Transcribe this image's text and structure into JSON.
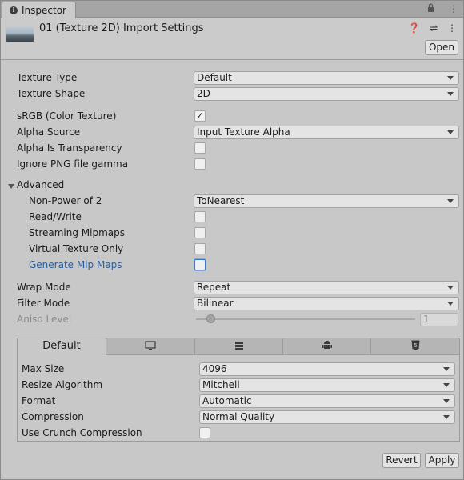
{
  "tab": {
    "label": "Inspector"
  },
  "header": {
    "title": "01 (Texture 2D) Import Settings",
    "open_label": "Open",
    "icons": [
      "help-icon",
      "presets-icon",
      "more-icon"
    ]
  },
  "settings": {
    "texture_type": {
      "label": "Texture Type",
      "value": "Default"
    },
    "texture_shape": {
      "label": "Texture Shape",
      "value": "2D"
    },
    "srgb": {
      "label": "sRGB (Color Texture)",
      "checked": true,
      "mark": "✓"
    },
    "alpha_source": {
      "label": "Alpha Source",
      "value": "Input Texture Alpha"
    },
    "alpha_transparency": {
      "label": "Alpha Is Transparency"
    },
    "ignore_png": {
      "label": "Ignore PNG file gamma"
    }
  },
  "advanced": {
    "label": "Advanced",
    "npot": {
      "label": "Non-Power of 2",
      "value": "ToNearest"
    },
    "read_write": {
      "label": "Read/Write"
    },
    "streaming": {
      "label": "Streaming Mipmaps"
    },
    "virtual": {
      "label": "Virtual Texture Only"
    },
    "mipmaps": {
      "label": "Generate Mip Maps"
    }
  },
  "wrap": {
    "label": "Wrap Mode",
    "value": "Repeat"
  },
  "filter": {
    "label": "Filter Mode",
    "value": "Bilinear"
  },
  "aniso": {
    "label": "Aniso Level",
    "value": "1"
  },
  "platform": {
    "tabs": [
      "Default",
      "standalone-icon",
      "server-icon",
      "android-icon",
      "webgl-icon"
    ],
    "default_label": "Default",
    "max_size": {
      "label": "Max Size",
      "value": "4096"
    },
    "resize": {
      "label": "Resize Algorithm",
      "value": "Mitchell"
    },
    "format": {
      "label": "Format",
      "value": "Automatic"
    },
    "compression": {
      "label": "Compression",
      "value": "Normal Quality"
    },
    "crunch": {
      "label": "Use Crunch Compression"
    }
  },
  "footer": {
    "revert_label": "Revert",
    "apply_label": "Apply"
  }
}
